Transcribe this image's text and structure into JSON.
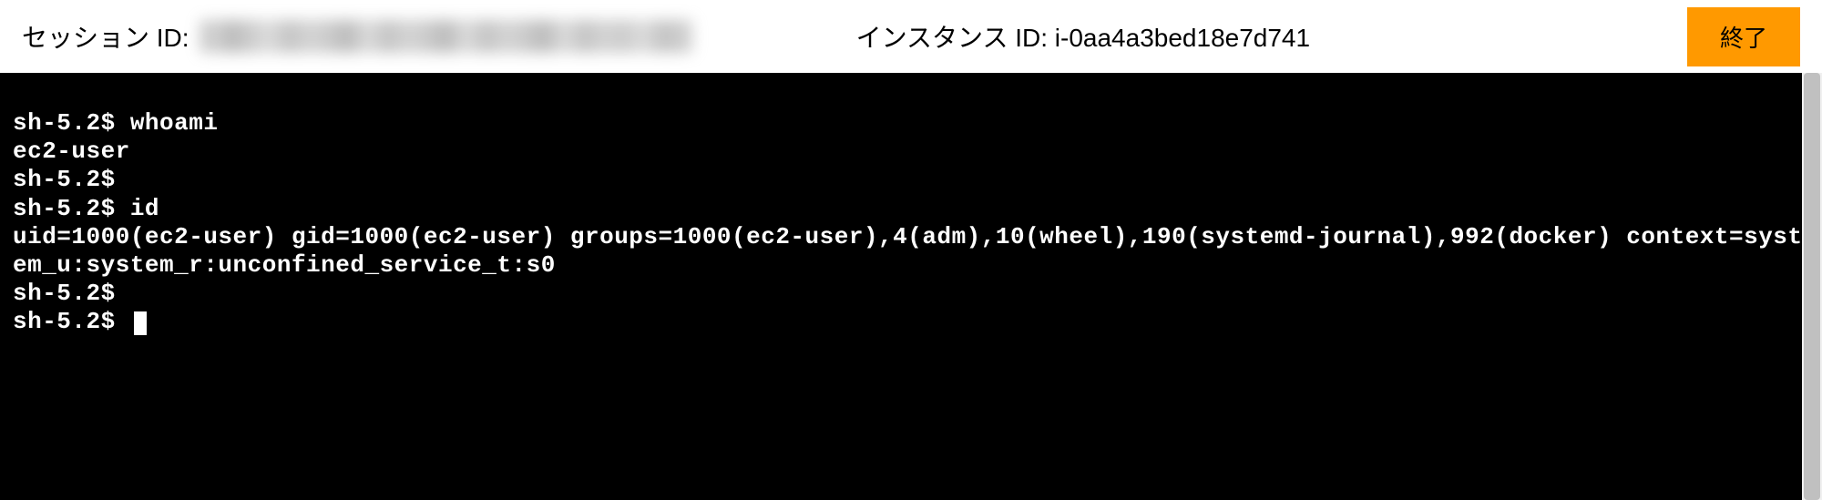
{
  "header": {
    "session_label": "セッション ID:",
    "instance_label": "インスタンス ID:",
    "instance_id": "i-0aa4a3bed18e7d741",
    "end_button_label": "終了"
  },
  "terminal": {
    "lines": [
      {
        "prompt": "sh-5.2$ ",
        "command": "whoami"
      },
      {
        "output": "ec2-user"
      },
      {
        "prompt": "sh-5.2$",
        "command": ""
      },
      {
        "prompt": "sh-5.2$ ",
        "command": "id"
      },
      {
        "output": "uid=1000(ec2-user) gid=1000(ec2-user) groups=1000(ec2-user),4(adm),10(wheel),190(systemd-journal),992(docker) context=system_u:system_r:unconfined_service_t:s0"
      },
      {
        "prompt": "sh-5.2$",
        "command": ""
      },
      {
        "prompt": "sh-5.2$ ",
        "command": "",
        "cursor": true
      }
    ]
  }
}
